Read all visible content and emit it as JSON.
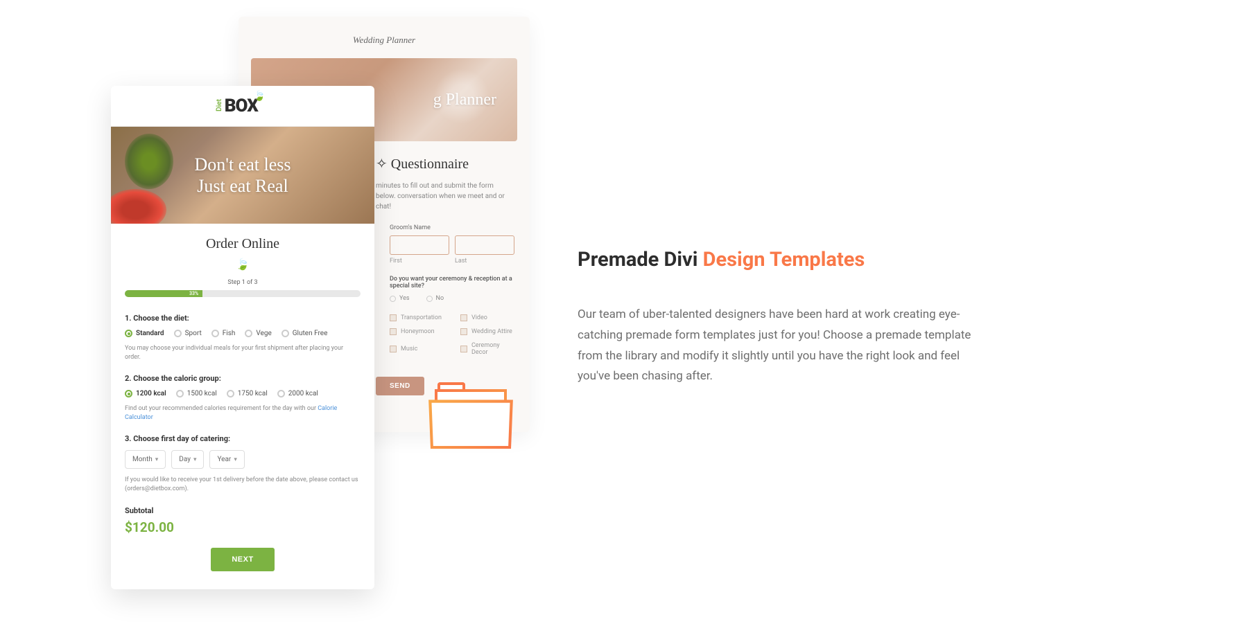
{
  "heading": {
    "part1": "Premade Divi ",
    "part2": "Design Templates"
  },
  "description": "Our team of uber-talented designers have been hard at work creating eye-catching premade form templates just for you! Choose a premade template from the library and modify it slightly until you have the right look and feel you've been chasing after.",
  "wedding": {
    "logo": "Wedding Planner",
    "hero_text": "g Planner",
    "q_title": "Questionnaire",
    "q_sub": "minutes to fill out and submit the form below. conversation when we meet and or chat!",
    "field_label": "Groom's Name",
    "first": "First",
    "last": "Last",
    "question": "Do you want your ceremony & reception at a special site?",
    "yes": "Yes",
    "no": "No",
    "checks": [
      "Transportation",
      "Video",
      "Honeymoon",
      "Wedding Attire",
      "Music",
      "Ceremony Decor"
    ],
    "send": "SEND"
  },
  "diet": {
    "logo_diet": "Diet",
    "logo_box": "BOX",
    "hero_line1": "Don't eat less",
    "hero_line2": "Just eat Real",
    "title": "Order Online",
    "step": "Step 1 of 3",
    "progress_pct": "33%",
    "s1_title": "1. Choose the diet:",
    "s1_options": [
      "Standard",
      "Sport",
      "Fish",
      "Vege",
      "Gluten Free"
    ],
    "s1_hint": "You may choose your individual meals for your first shipment after placing your order.",
    "s2_title": "2. Choose the caloric group:",
    "s2_options": [
      "1200 kcal",
      "1500 kcal",
      "1750 kcal",
      "2000 kcal"
    ],
    "s2_hint_pre": "Find out your recommended calories requirement for the day with our ",
    "s2_hint_link": "Calorie Calculator",
    "s3_title": "3. Choose first day of catering:",
    "s3_selects": [
      "Month",
      "Day",
      "Year"
    ],
    "s3_hint": "If you would like to receive your 1st delivery before the date above, please contact us (orders@dietbox.com).",
    "subtotal": "Subtotal",
    "price": "$120.00",
    "next": "NEXT"
  }
}
